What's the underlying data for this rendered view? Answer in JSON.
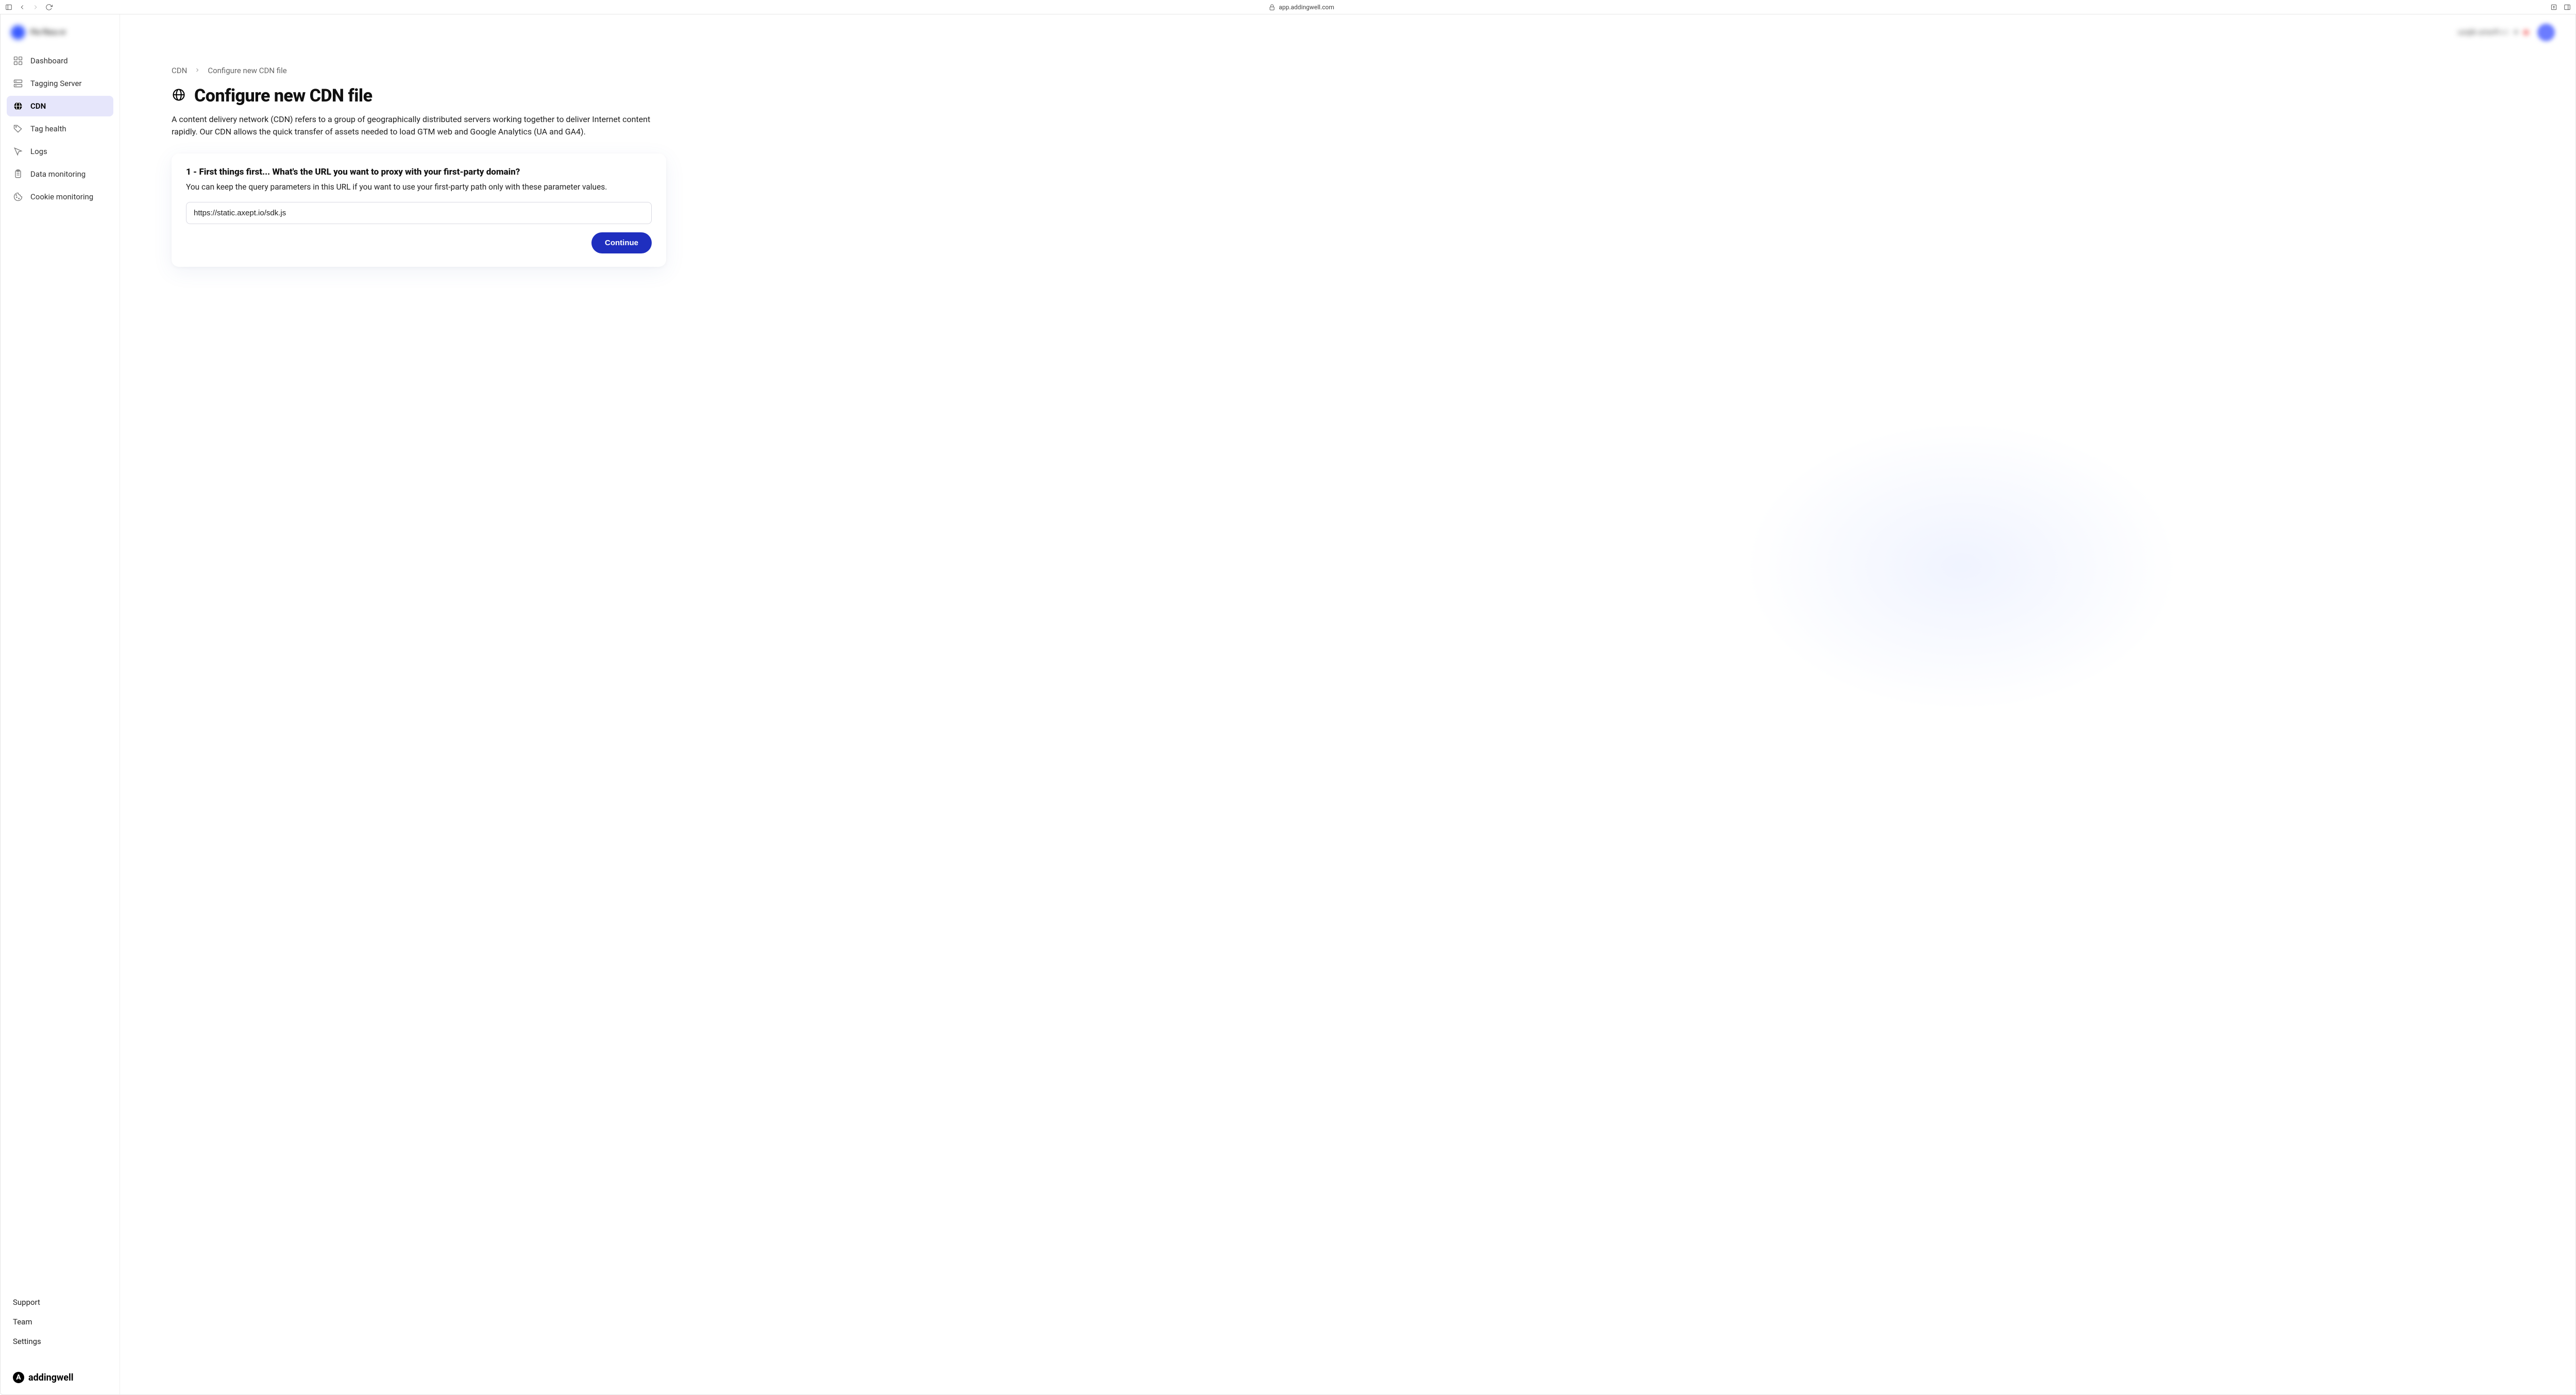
{
  "chrome": {
    "url": "app.addingwell.com"
  },
  "sidebar": {
    "header_text": "Flo    Fbcu   vr",
    "items": [
      {
        "label": "Dashboard"
      },
      {
        "label": "Tagging Server"
      },
      {
        "label": "CDN"
      },
      {
        "label": "Tag health"
      },
      {
        "label": "Logs"
      },
      {
        "label": "Data monitoring"
      },
      {
        "label": "Cookie monitoring"
      }
    ],
    "bottom": {
      "support": "Support",
      "team": "Team",
      "settings": "Settings"
    },
    "brand": "addingwell"
  },
  "topbar": {
    "account_text": "uzxjik  umxrft v i"
  },
  "breadcrumb": {
    "root": "CDN",
    "current": "Configure new CDN file"
  },
  "page": {
    "title": "Configure new CDN file",
    "description": "A content delivery network (CDN) refers to a group of geographically distributed servers working together to deliver Internet content rapidly. Our CDN allows the quick transfer of assets needed to load GTM web and Google Analytics (UA and GA4)."
  },
  "step1": {
    "title": "1 - First things first... What's the URL you want to proxy with your first-party domain?",
    "description": "You can keep the query parameters in this URL if you want to use your first-party path only with these parameter values.",
    "input_value": "https://static.axept.io/sdk.js",
    "continue_label": "Continue"
  }
}
